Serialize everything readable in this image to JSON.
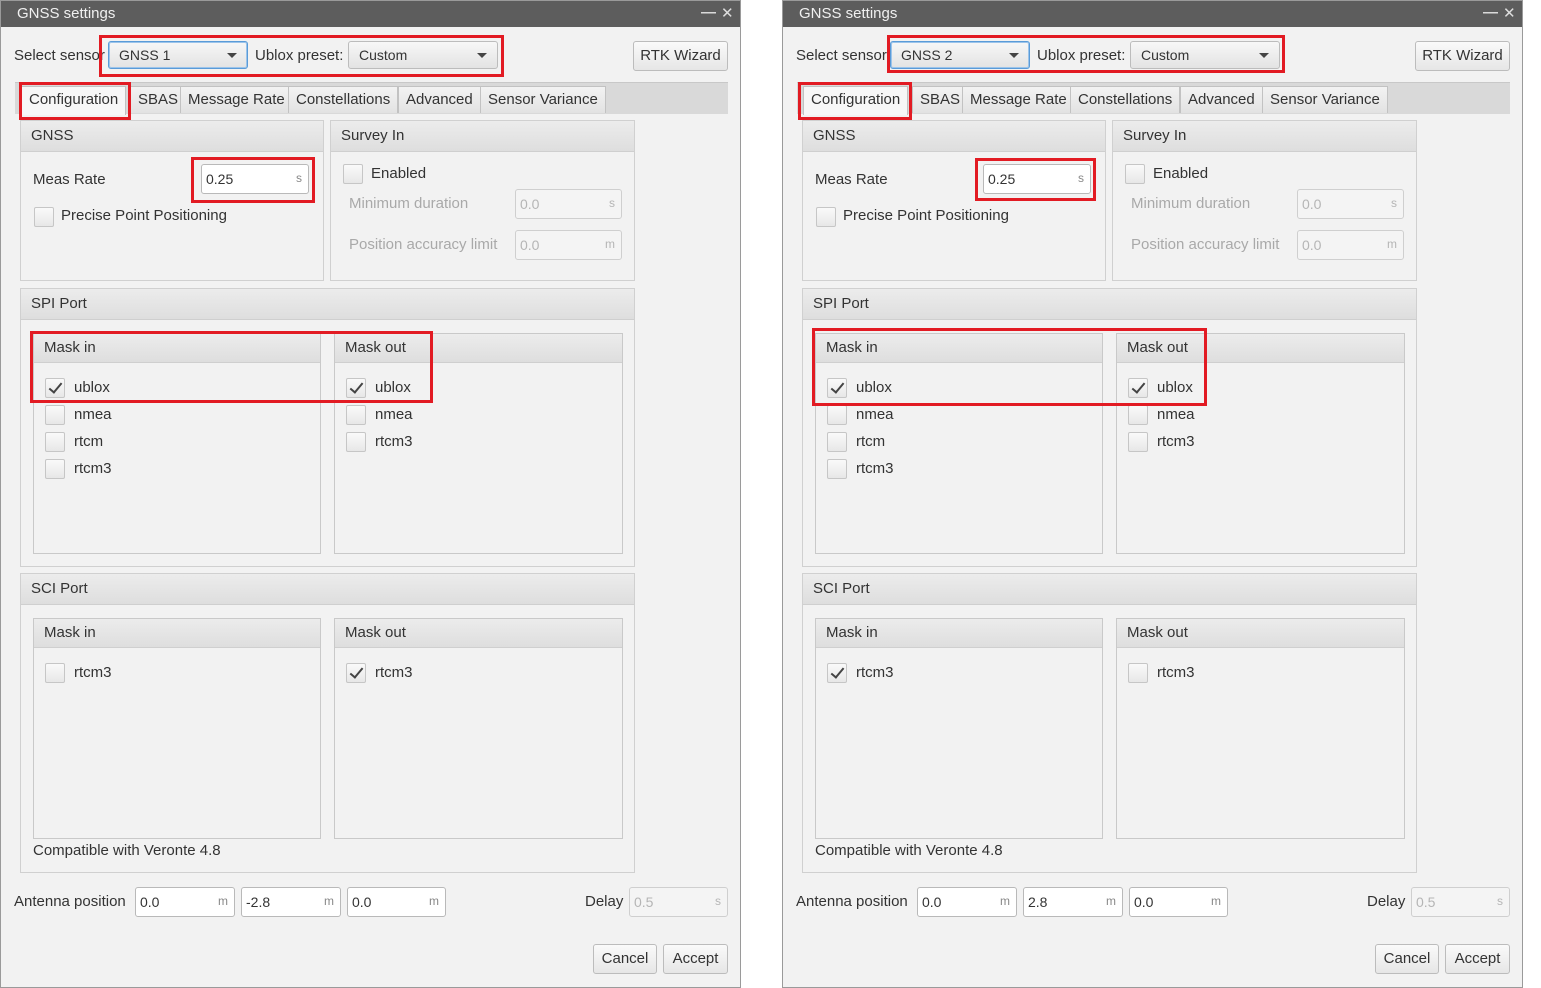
{
  "dialogs": [
    {
      "title": "GNSS settings",
      "select_sensor_label": "Select sensor",
      "sensor": "GNSS 1",
      "ublox_preset_label": "Ublox preset:",
      "ublox_preset": "Custom",
      "rtk_wizard": "RTK Wizard",
      "tabs": [
        "Configuration",
        "SBAS",
        "Message Rate",
        "Constellations",
        "Advanced",
        "Sensor Variance"
      ],
      "gnss": {
        "header": "GNSS",
        "meas_rate_label": "Meas Rate",
        "meas_rate": "0.25",
        "meas_rate_unit": "s",
        "ppp_label": "Precise Point Positioning",
        "ppp_checked": false
      },
      "survey_in": {
        "header": "Survey In",
        "enabled_label": "Enabled",
        "enabled_checked": false,
        "min_duration_label": "Minimum duration",
        "min_duration": "0.0",
        "min_duration_unit": "s",
        "pos_acc_label": "Position accuracy limit",
        "pos_acc": "0.0",
        "pos_acc_unit": "m"
      },
      "spi": {
        "header": "SPI Port",
        "mask_in": {
          "header": "Mask in",
          "items": [
            {
              "label": "ublox",
              "checked": true
            },
            {
              "label": "nmea",
              "checked": false
            },
            {
              "label": "rtcm",
              "checked": false
            },
            {
              "label": "rtcm3",
              "checked": false
            }
          ]
        },
        "mask_out": {
          "header": "Mask out",
          "items": [
            {
              "label": "ublox",
              "checked": true
            },
            {
              "label": "nmea",
              "checked": false
            },
            {
              "label": "rtcm3",
              "checked": false
            }
          ]
        }
      },
      "sci": {
        "header": "SCI Port",
        "mask_in": {
          "header": "Mask in",
          "items": [
            {
              "label": "rtcm3",
              "checked": false
            }
          ]
        },
        "mask_out": {
          "header": "Mask out",
          "items": [
            {
              "label": "rtcm3",
              "checked": true
            }
          ]
        },
        "compat": "Compatible with Veronte 4.8"
      },
      "antenna": {
        "label": "Antenna position",
        "x": "0.0",
        "y": "-2.8",
        "z": "0.0",
        "unit": "m"
      },
      "delay": {
        "label": "Delay",
        "value": "0.5",
        "unit": "s"
      },
      "cancel": "Cancel",
      "accept": "Accept"
    },
    {
      "title": "GNSS settings",
      "select_sensor_label": "Select sensor",
      "sensor": "GNSS 2",
      "ublox_preset_label": "Ublox preset:",
      "ublox_preset": "Custom",
      "rtk_wizard": "RTK Wizard",
      "tabs": [
        "Configuration",
        "SBAS",
        "Message Rate",
        "Constellations",
        "Advanced",
        "Sensor Variance"
      ],
      "gnss": {
        "header": "GNSS",
        "meas_rate_label": "Meas Rate",
        "meas_rate": "0.25",
        "meas_rate_unit": "s",
        "ppp_label": "Precise Point Positioning",
        "ppp_checked": false
      },
      "survey_in": {
        "header": "Survey In",
        "enabled_label": "Enabled",
        "enabled_checked": false,
        "min_duration_label": "Minimum duration",
        "min_duration": "0.0",
        "min_duration_unit": "s",
        "pos_acc_label": "Position accuracy limit",
        "pos_acc": "0.0",
        "pos_acc_unit": "m"
      },
      "spi": {
        "header": "SPI Port",
        "mask_in": {
          "header": "Mask in",
          "items": [
            {
              "label": "ublox",
              "checked": true
            },
            {
              "label": "nmea",
              "checked": false
            },
            {
              "label": "rtcm",
              "checked": false
            },
            {
              "label": "rtcm3",
              "checked": false
            }
          ]
        },
        "mask_out": {
          "header": "Mask out",
          "items": [
            {
              "label": "ublox",
              "checked": true
            },
            {
              "label": "nmea",
              "checked": false
            },
            {
              "label": "rtcm3",
              "checked": false
            }
          ]
        }
      },
      "sci": {
        "header": "SCI Port",
        "mask_in": {
          "header": "Mask in",
          "items": [
            {
              "label": "rtcm3",
              "checked": true
            }
          ]
        },
        "mask_out": {
          "header": "Mask out",
          "items": [
            {
              "label": "rtcm3",
              "checked": false
            }
          ]
        },
        "compat": "Compatible with Veronte 4.8"
      },
      "antenna": {
        "label": "Antenna position",
        "x": "0.0",
        "y": "2.8",
        "z": "0.0",
        "unit": "m"
      },
      "delay": {
        "label": "Delay",
        "value": "0.5",
        "unit": "s"
      },
      "cancel": "Cancel",
      "accept": "Accept"
    }
  ],
  "colors": {
    "highlight": "#e21b23",
    "titlebar": "#5d5d5d",
    "background": "#f2f2f2"
  }
}
